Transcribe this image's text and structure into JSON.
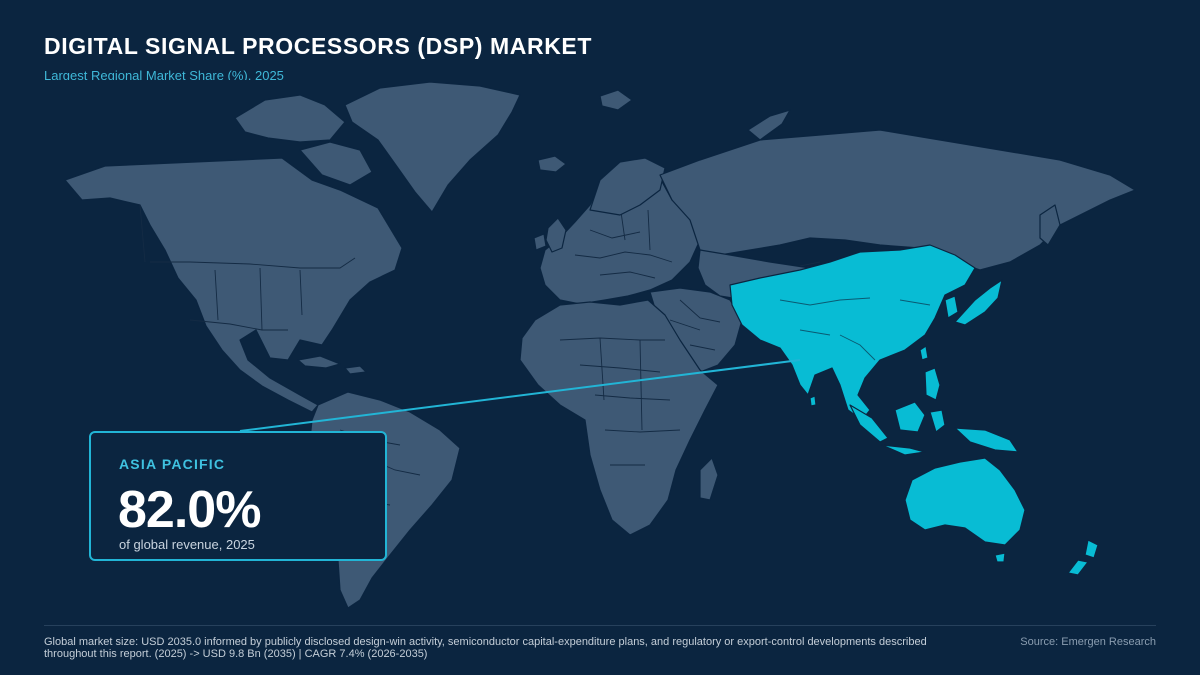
{
  "title": "DIGITAL SIGNAL PROCESSORS (DSP) MARKET",
  "subtitle": "Largest Regional Market Share (%), 2025",
  "highlight": {
    "region": "ASIA PACIFIC",
    "share": "82.0%",
    "caption": "of global revenue, 2025",
    "color": "#08bcd4"
  },
  "colors": {
    "background": "#0b2540",
    "land": "#3e5975",
    "accent": "#22b5d6"
  },
  "footnote": "Global market size: USD 2035.0 informed by publicly disclosed design-win activity, semiconductor capital-expenditure plans, and regulatory or export-control developments described throughout this report. (2025) -> USD 9.8 Bn (2035) | CAGR 7.4% (2026-2035)",
  "source": "Source: Emergen Research"
}
